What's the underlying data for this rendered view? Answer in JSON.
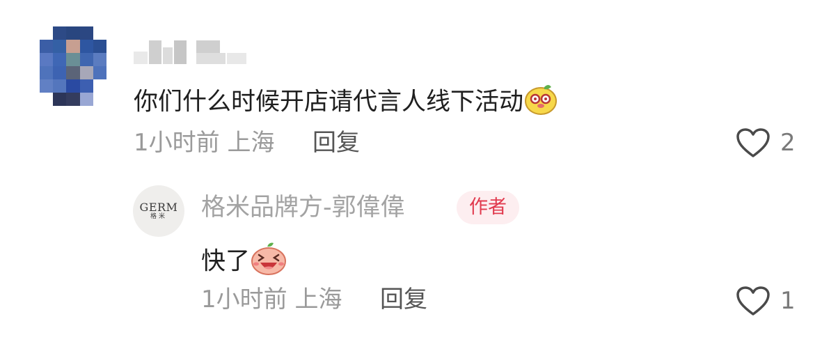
{
  "comment": {
    "text": "你们什么时候开店请代言人线下活动",
    "emoji_icon": "yellow-monster-emoji-icon",
    "time": "1小时前",
    "location": "上海",
    "reply_label": "回复",
    "like_count": "2"
  },
  "reply": {
    "author_name": "格米品牌方-郭偉偉",
    "author_badge": "作者",
    "avatar_text_line1": "GERM",
    "avatar_text_line2": "格米",
    "text": "快了",
    "emoji_icon": "laughing-peach-emoji-icon",
    "time": "1小时前",
    "location": "上海",
    "reply_label": "回复",
    "like_count": "1"
  },
  "colors": {
    "badge_text": "#e13a4e",
    "badge_bg": "#fdeef0",
    "meta_text": "#9a9a9a",
    "body_text": "#1f1f1f"
  }
}
